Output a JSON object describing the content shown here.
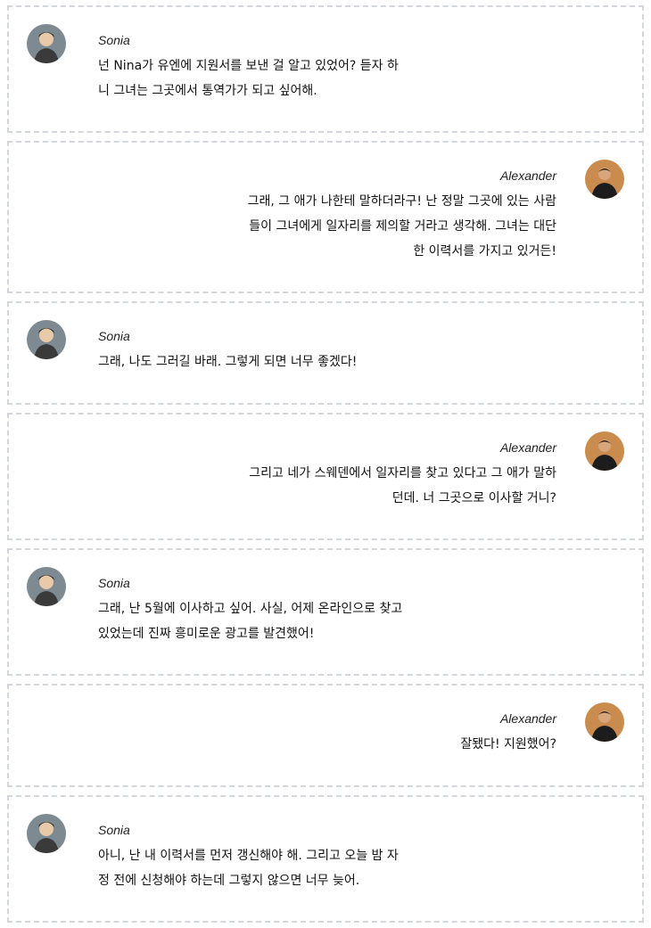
{
  "messages": [
    {
      "speaker": "Sonia",
      "side": "left",
      "text": "넌 Nina가 유엔에 지원서를 보낸 걸 알고 있었어?  듣자 하\n니 그녀는 그곳에서 통역가가 되고 싶어해."
    },
    {
      "speaker": "Alexander",
      "side": "right",
      "text": "그래, 그 애가 나한테 말하더라구! 난 정말 그곳에 있는 사람\n들이 그녀에게 일자리를 제의할 거라고 생각해. 그녀는 대단\n한 이력서를 가지고 있거든!"
    },
    {
      "speaker": "Sonia",
      "side": "left",
      "text": "그래, 나도 그러길 바래. 그렇게 되면 너무 좋겠다!"
    },
    {
      "speaker": "Alexander",
      "side": "right",
      "text": "그리고 네가 스웨덴에서 일자리를 찾고 있다고 그 애가 말하\n던데. 너 그곳으로 이사할 거니?"
    },
    {
      "speaker": "Sonia",
      "side": "left",
      "text": "그래, 난 5월에 이사하고 싶어. 사실, 어제 온라인으로 찾고\n있었는데 진짜 흥미로운 광고를 발견했어!"
    },
    {
      "speaker": "Alexander",
      "side": "right",
      "text": "잘됐다!  지원했어?"
    },
    {
      "speaker": "Sonia",
      "side": "left",
      "text": "아니, 난 내 이력서를 먼저 갱신해야 해. 그리고 오늘 밤 자\n정 전에 신청해야 하는데 그렇지 않으면 너무 늦어."
    }
  ],
  "colors": {
    "border": "#d3d6da",
    "sonia_avatar": "#7d8a92",
    "alex_avatar": "#c98c4e"
  },
  "icons": {
    "sonia": "sonia-avatar-icon",
    "alexander": "alexander-avatar-icon"
  }
}
